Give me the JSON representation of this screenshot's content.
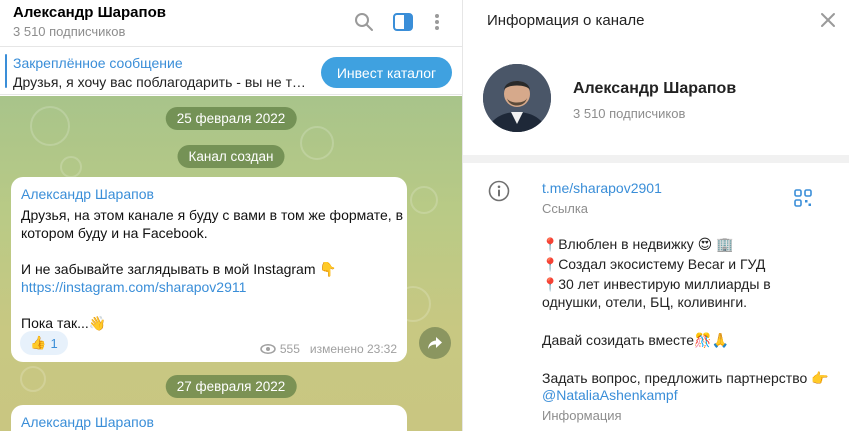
{
  "chat": {
    "title": "Александр Шарапов",
    "subscribers": "3 510 подписчиков",
    "pinned": {
      "label": "Закреплённое сообщение",
      "text": "Друзья, я хочу вас поблагодарить - вы не тол...",
      "button": "Инвест каталог"
    },
    "dates": [
      "25 февраля 2022",
      "27 февраля 2022"
    ],
    "service": "Канал создан",
    "message": {
      "author": "Александр Шарапов",
      "line1": "Друзья, на этом канале я буду с вами в том же формате, в",
      "line2": "котором буду и на Facebook.",
      "line3": "И не забывайте заглядывать в мой Instagram",
      "link": "https://instagram.com/sharapov2911",
      "line4": "Пока так...",
      "reaction_count": "1",
      "views": "555",
      "edited": "изменено 23:32"
    },
    "next_author": "Александр Шарапов"
  },
  "info": {
    "title": "Информация о канале",
    "name": "Александр Шарапов",
    "subscribers": "3 510 подписчиков",
    "link": "t.me/sharapov2901",
    "link_caption": "Ссылка",
    "desc1": "Влюблен в недвижку",
    "desc2": "Создал экосистему Becar и ГУД",
    "desc3": "30 лет инвестирую миллиарды в",
    "desc4": "однушки, отели, БЦ, коливинги.",
    "desc5": "Давай созидать вместе",
    "desc6": "Задать вопрос, предложить партнерство",
    "desc_link": "@NataliaAshenkampf",
    "desc_caption": "Информация"
  },
  "colors": {
    "accent": "#3a8ed8",
    "button": "#3fa1e0",
    "chat_bg": "#b5c886"
  },
  "icons": [
    "search-icon",
    "sidebar-toggle-icon",
    "more-vertical-icon",
    "close-icon",
    "info-icon",
    "qr-code-icon",
    "share-icon",
    "views-icon",
    "thumbs-up-icon"
  ]
}
